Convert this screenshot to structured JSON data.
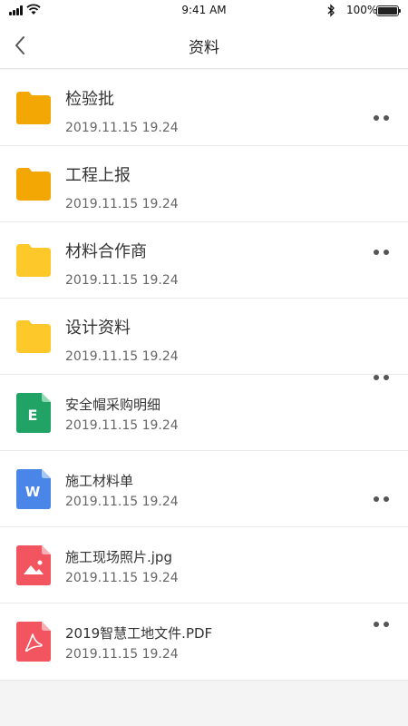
{
  "status_bar": {
    "time": "9:41 AM",
    "battery_text": "100%",
    "battery_level": 1.0,
    "icons": [
      "signal-icon",
      "wifi-icon",
      "bluetooth-icon",
      "battery-icon"
    ]
  },
  "header": {
    "title": "资料",
    "back_icon": "chevron-left-icon"
  },
  "files": [
    {
      "name": "检验批",
      "date": "2019.11.15 19.24",
      "type": "folder",
      "color": "#f2a705"
    },
    {
      "name": "工程上报",
      "date": "2019.11.15 19.24",
      "type": "folder",
      "color": "#f2a705"
    },
    {
      "name": "材料合作商",
      "date": "2019.11.15 19.24",
      "type": "folder",
      "color": "#fdc82a"
    },
    {
      "name": "设计资料",
      "date": "2019.11.15 19.24",
      "type": "folder",
      "color": "#fdc82a"
    },
    {
      "name": "安全帽采购明细",
      "date": "2019.11.15 19.24",
      "type": "excel",
      "letter": "E",
      "color": "#21a366"
    },
    {
      "name": "施工材料单",
      "date": "2019.11.15 19.24",
      "type": "word",
      "letter": "W",
      "color": "#4a86e8"
    },
    {
      "name": "施工现场照片.jpg",
      "date": "2019.11.15 19.24",
      "type": "image",
      "color": "#f25560"
    },
    {
      "name": "2019智慧工地文件.PDF",
      "date": "2019.11.15 19.24",
      "type": "pdf",
      "color": "#f25560"
    }
  ],
  "more_icon": "more-dots-icon",
  "colors": {
    "background": "#f4f4f5",
    "divider": "#e8e8e8",
    "folder_dark": "#f2a705",
    "folder_light": "#fdc82a"
  }
}
